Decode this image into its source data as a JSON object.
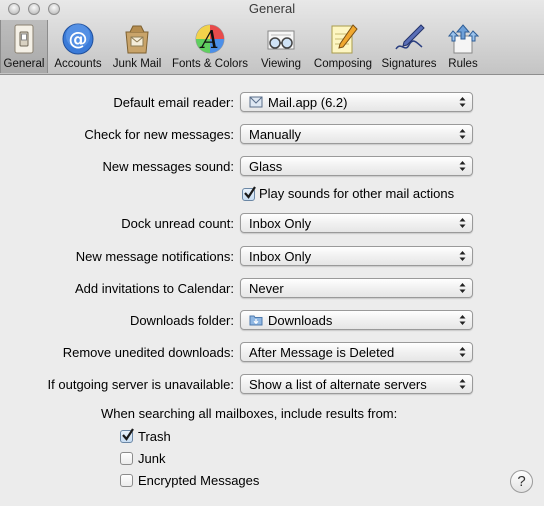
{
  "window": {
    "title": "General"
  },
  "toolbar": {
    "items": [
      {
        "label": "General",
        "icon": "light-switch-icon",
        "selected": true
      },
      {
        "label": "Accounts",
        "icon": "at-sign-icon"
      },
      {
        "label": "Junk Mail",
        "icon": "junk-mail-bag-icon"
      },
      {
        "label": "Fonts & Colors",
        "icon": "fonts-colors-icon"
      },
      {
        "label": "Viewing",
        "icon": "glasses-icon"
      },
      {
        "label": "Composing",
        "icon": "pencil-pad-icon"
      },
      {
        "label": "Signatures",
        "icon": "signature-pen-icon"
      },
      {
        "label": "Rules",
        "icon": "rules-arrows-icon"
      }
    ]
  },
  "settings": [
    {
      "label": "Default email reader:",
      "value": "Mail.app (6.2)",
      "icon": "mail-app-icon"
    },
    {
      "label": "Check for new messages:",
      "value": "Manually"
    },
    {
      "label": "New messages sound:",
      "value": "Glass"
    },
    {
      "label": "Dock unread count:",
      "value": "Inbox Only"
    },
    {
      "label": "New message notifications:",
      "value": "Inbox Only"
    },
    {
      "label": "Add invitations to Calendar:",
      "value": "Never"
    },
    {
      "label": "Downloads folder:",
      "value": "Downloads",
      "icon": "folder-icon"
    },
    {
      "label": "Remove unedited downloads:",
      "value": "After Message is Deleted"
    },
    {
      "label": "If outgoing server is unavailable:",
      "value": "Show a list of alternate servers"
    }
  ],
  "play_sounds": {
    "label": "Play sounds for other mail actions",
    "checked": true
  },
  "search": {
    "heading": "When searching all mailboxes, include results from:",
    "options": [
      {
        "label": "Trash",
        "checked": true
      },
      {
        "label": "Junk",
        "checked": false
      },
      {
        "label": "Encrypted Messages",
        "checked": false
      }
    ]
  },
  "help": {
    "label": "?"
  }
}
